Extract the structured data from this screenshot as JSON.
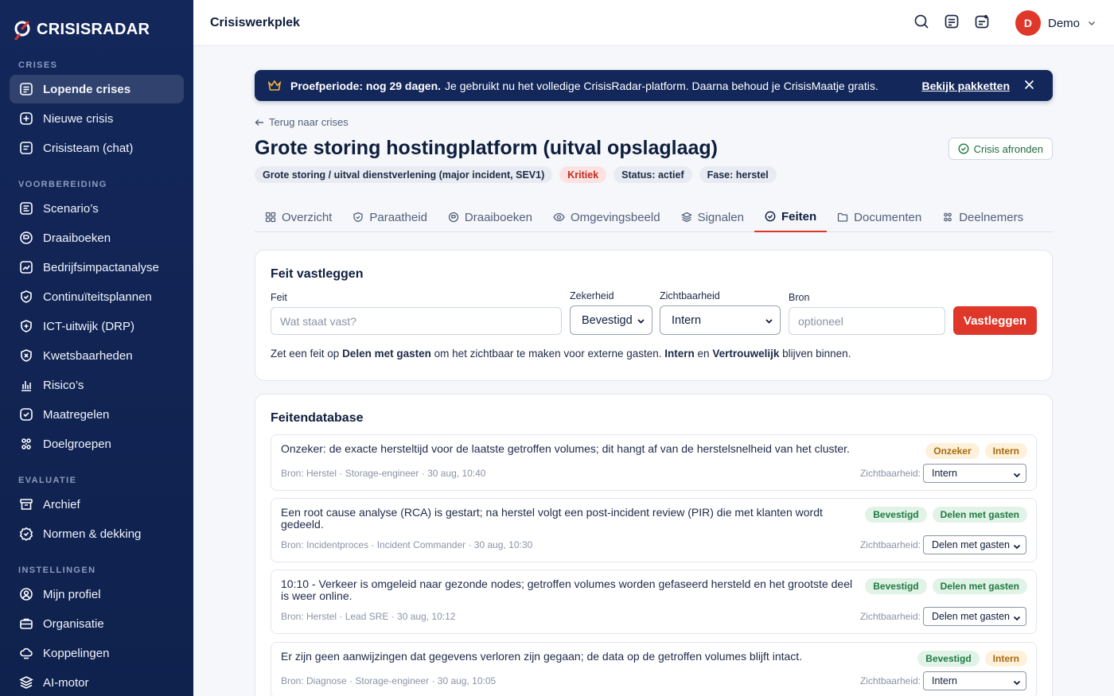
{
  "app": {
    "logo_text": "CRISISRADAR",
    "page_title": "Crisiswerkplek"
  },
  "user": {
    "initial": "D",
    "name": "Demo"
  },
  "sidebar": {
    "sections": [
      {
        "label": "CRISES",
        "items": [
          {
            "label": "Lopende crises",
            "icon": "list-icon",
            "active": true
          },
          {
            "label": "Nieuwe crisis",
            "icon": "plus-circle-icon"
          },
          {
            "label": "Crisisteam (chat)",
            "icon": "chat-icon"
          }
        ]
      },
      {
        "label": "VOORBEREIDING",
        "items": [
          {
            "label": "Scenario’s",
            "icon": "scenario-icon"
          },
          {
            "label": "Draaiboeken",
            "icon": "book-icon"
          },
          {
            "label": "Bedrijfsimpactanalyse",
            "icon": "analysis-icon"
          },
          {
            "label": "Continuïteitsplannen",
            "icon": "shield-icon"
          },
          {
            "label": "ICT-uitwijk (DRP)",
            "icon": "shield-plus-icon"
          },
          {
            "label": "Kwetsbaarheden",
            "icon": "shield-x-icon"
          },
          {
            "label": "Risico’s",
            "icon": "bar-chart-icon"
          },
          {
            "label": "Maatregelen",
            "icon": "check-square-icon"
          },
          {
            "label": "Doelgroepen",
            "icon": "groups-icon"
          }
        ]
      },
      {
        "label": "EVALUATIE",
        "items": [
          {
            "label": "Archief",
            "icon": "archive-icon"
          },
          {
            "label": "Normen & dekking",
            "icon": "badge-check-icon"
          }
        ]
      },
      {
        "label": "INSTELLINGEN",
        "items": [
          {
            "label": "Mijn profiel",
            "icon": "user-circle-icon"
          },
          {
            "label": "Organisatie",
            "icon": "briefcase-icon"
          },
          {
            "label": "Koppelingen",
            "icon": "cloud-icon"
          },
          {
            "label": "AI-motor",
            "icon": "layers-icon"
          }
        ]
      }
    ]
  },
  "banner": {
    "bold": "Proefperiode: nog 29 dagen.",
    "text": "Je gebruikt nu het volledige CrisisRadar-platform. Daarna behoud je CrisisMaatje gratis.",
    "link": "Bekijk pakketten"
  },
  "crisis": {
    "back": "Terug naar crises",
    "title": "Grote storing hostingplatform (uitval opslaglaag)",
    "finish_label": "Crisis afronden",
    "badges": {
      "type": "Grote storing / uitval dienstverlening (major incident, SEV1)",
      "severity": "Kritiek",
      "status": "Status: actief",
      "phase": "Fase: herstel"
    }
  },
  "tabs": [
    {
      "label": "Overzicht",
      "icon": "grid-icon"
    },
    {
      "label": "Paraatheid",
      "icon": "shield-check-icon"
    },
    {
      "label": "Draaiboeken",
      "icon": "book-icon"
    },
    {
      "label": "Omgevingsbeeld",
      "icon": "eye-icon"
    },
    {
      "label": "Signalen",
      "icon": "stack-icon"
    },
    {
      "label": "Feiten",
      "icon": "check-circle-icon",
      "active": true
    },
    {
      "label": "Documenten",
      "icon": "folder-icon"
    },
    {
      "label": "Deelnemers",
      "icon": "people-icon"
    }
  ],
  "form": {
    "title": "Feit vastleggen",
    "fact_label": "Feit",
    "fact_placeholder": "Wat staat vast?",
    "certainty_label": "Zekerheid",
    "certainty_value": "Bevestigd",
    "visibility_label": "Zichtbaarheid",
    "visibility_value": "Intern",
    "source_label": "Bron",
    "source_placeholder": "optioneel",
    "submit": "Vastleggen",
    "helper": {
      "p1": "Zet een feit op ",
      "b1": "Delen met gasten",
      "p2": " om het zichtbaar te maken voor externe gasten. ",
      "b2": "Intern",
      "p3": " en ",
      "b3": "Vertrouwelijk",
      "p4": " blijven binnen."
    }
  },
  "database": {
    "title": "Feitendatabase",
    "visibility_label": "Zichtbaarheid:",
    "facts": [
      {
        "text": "Onzeker: de exacte hersteltijd voor de laatste getroffen volumes; dit hangt af van de herstelsnelheid van het cluster.",
        "meta": "Bron: Herstel · Storage-engineer · 30 aug, 10:40",
        "certainty": "Onzeker",
        "visibility": "Intern"
      },
      {
        "text": "Een root cause analyse (RCA) is gestart; na herstel volgt een post-incident review (PIR) die met klanten wordt gedeeld.",
        "meta": "Bron: Incidentproces · Incident Commander · 30 aug, 10:30",
        "certainty": "Bevestigd",
        "visibility": "Delen met gasten"
      },
      {
        "text": "10:10 - Verkeer is omgeleid naar gezonde nodes; getroffen volumes worden gefaseerd hersteld en het grootste deel is weer online.",
        "meta": "Bron: Herstel · Lead SRE · 30 aug, 10:12",
        "certainty": "Bevestigd",
        "visibility": "Delen met gasten"
      },
      {
        "text": "Er zijn geen aanwijzingen dat gegevens verloren zijn gegaan; de data op de getroffen volumes blijft intact.",
        "meta": "Bron: Diagnose · Storage-engineer · 30 aug, 10:05",
        "certainty": "Bevestigd",
        "visibility": "Intern"
      }
    ]
  },
  "colors": {
    "sidebar": "#13275a",
    "accent": "#e0372b",
    "confirmed": "#1f7a43",
    "warning": "#a76a0c"
  }
}
